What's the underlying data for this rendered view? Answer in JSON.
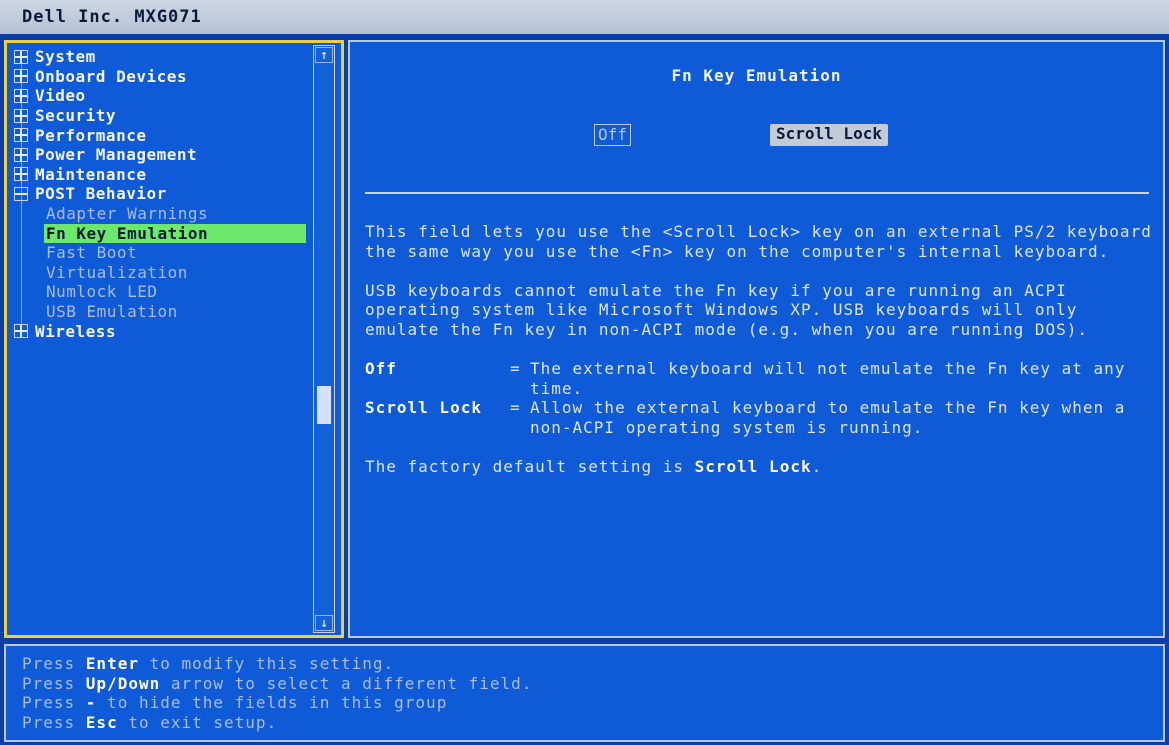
{
  "window": {
    "title": "Dell Inc. MXG071"
  },
  "tree": {
    "items": [
      {
        "label": "System",
        "expander": "plus"
      },
      {
        "label": "Onboard Devices",
        "expander": "plus"
      },
      {
        "label": "Video",
        "expander": "plus"
      },
      {
        "label": "Security",
        "expander": "plus"
      },
      {
        "label": "Performance",
        "expander": "plus"
      },
      {
        "label": "Power Management",
        "expander": "plus"
      },
      {
        "label": "Maintenance",
        "expander": "plus"
      },
      {
        "label": "POST Behavior",
        "expander": "minus"
      },
      {
        "label": "Adapter Warnings",
        "child": true
      },
      {
        "label": "Fn Key Emulation",
        "child": true,
        "selected": true
      },
      {
        "label": "Fast Boot",
        "child": true
      },
      {
        "label": "Virtualization",
        "child": true
      },
      {
        "label": "Numlock LED",
        "child": true
      },
      {
        "label": "USB Emulation",
        "child": true
      },
      {
        "label": "Wireless",
        "expander": "plus"
      }
    ]
  },
  "scrollbar": {
    "up_glyph": "↑",
    "down_glyph": "↓"
  },
  "setting": {
    "title": "Fn Key Emulation",
    "options": {
      "off": "Off",
      "scroll_lock": "Scroll Lock"
    },
    "selected": "Scroll Lock",
    "desc": {
      "p1": "This field lets you use the <Scroll Lock> key on an external PS/2 keyboard the same way you use the <Fn> key on the computer's internal keyboard.",
      "p2": "USB keyboards cannot emulate the Fn key if you are running an ACPI operating system like Microsoft Windows XP.  USB keyboards will only emulate the Fn key in non-ACPI mode (e.g. when you are running DOS).",
      "def_off_term": "Off",
      "def_off_text": "The external keyboard will not emulate the Fn key at any time.",
      "def_sl_term": "Scroll Lock",
      "def_sl_text": "Allow the external keyboard to emulate the Fn key when a non-ACPI operating system is running.",
      "eq": "=",
      "default_prefix": "The factory default setting is ",
      "default_value": "Scroll Lock",
      "default_suffix": "."
    }
  },
  "help": {
    "l1_pre": "Press ",
    "l1_key": "Enter",
    "l1_post": " to modify this setting.",
    "l2_pre": "Press ",
    "l2_key": "Up/Down",
    "l2_post": " arrow to select a different field.",
    "l3_pre": "Press ",
    "l3_key": "-",
    "l3_post": " to hide the fields in this group",
    "l4_pre": "Press ",
    "l4_key": "Esc",
    "l4_post": " to exit setup."
  },
  "colors": {
    "background": "#0b3ea8",
    "panel": "#0f5ad6",
    "tree_focus_border": "#e9cf4a",
    "selection": "#6de86a",
    "option_highlight": "#c3cbd8"
  }
}
